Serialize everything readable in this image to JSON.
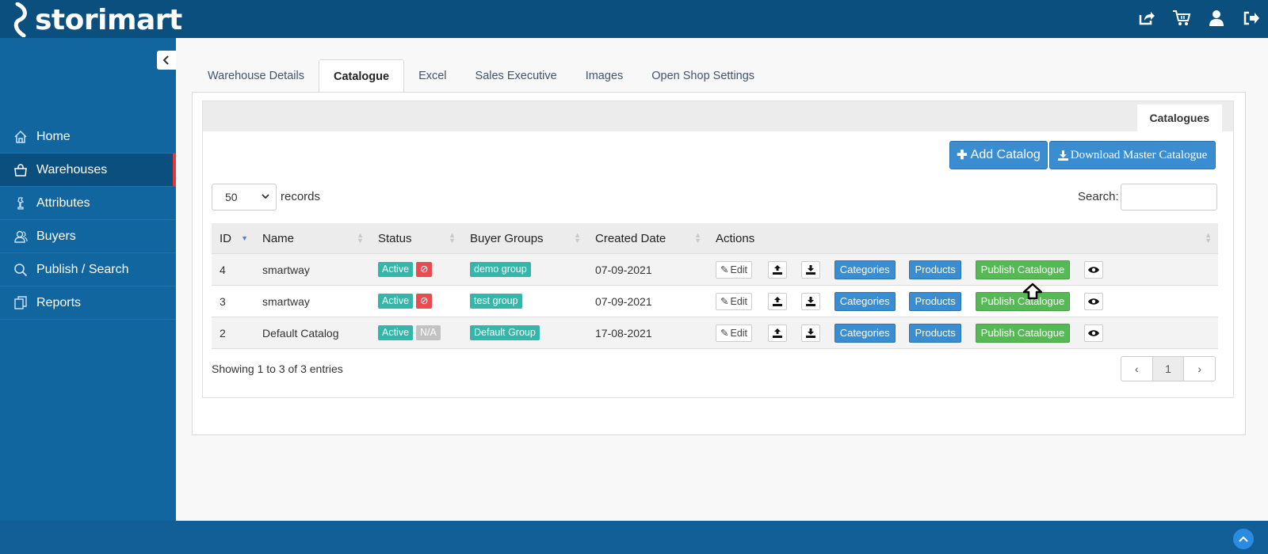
{
  "app": {
    "logo_text": "storimart"
  },
  "header": {
    "icons": [
      "share-icon",
      "cart-icon",
      "user-icon",
      "logout-icon"
    ]
  },
  "sidebar": {
    "items": [
      {
        "label": "Home",
        "icon": "home-icon"
      },
      {
        "label": "Warehouses",
        "icon": "bag-icon",
        "active": true
      },
      {
        "label": "Attributes",
        "icon": "chess-icon"
      },
      {
        "label": "Buyers",
        "icon": "users-icon"
      },
      {
        "label": "Publish / Search",
        "icon": "search-icon"
      },
      {
        "label": "Reports",
        "icon": "copy-icon"
      }
    ]
  },
  "tabs": [
    {
      "label": "Warehouse Details"
    },
    {
      "label": "Catalogue",
      "active": true
    },
    {
      "label": "Excel"
    },
    {
      "label": "Sales Executive"
    },
    {
      "label": "Images"
    },
    {
      "label": "Open Shop Settings"
    }
  ],
  "panel": {
    "section_tab": "Catalogues",
    "add_button": "Add Catalog",
    "download_button": "Download Master Catalogue",
    "page_length": "50",
    "records_label": "records",
    "search_label": "Search:",
    "search_value": ""
  },
  "table": {
    "columns": [
      "ID",
      "Name",
      "Status",
      "Buyer Groups",
      "Created Date",
      "Actions"
    ],
    "rows": [
      {
        "id": "4",
        "name": "smartway",
        "status": "Active",
        "status2": "⊘",
        "buyer_group": "demo group",
        "created": "07-09-2021"
      },
      {
        "id": "3",
        "name": "smartway",
        "status": "Active",
        "status2": "⊘",
        "buyer_group": "test group",
        "created": "07-09-2021"
      },
      {
        "id": "2",
        "name": "Default Catalog",
        "status": "Active",
        "status2": "N/A",
        "buyer_group": "Default Group",
        "created": "17-08-2021"
      }
    ],
    "action_labels": {
      "edit": "Edit",
      "categories": "Categories",
      "products": "Products",
      "publish": "Publish Catalogue"
    }
  },
  "footer": {
    "showing": "Showing 1 to 3 of 3 entries",
    "pager": {
      "prev": "‹",
      "current": "1",
      "next": "›"
    }
  },
  "colors": {
    "header_bg": "#0b4f7f",
    "sidebar_bg": "#1266a0",
    "accent_blue": "#3a8dd0",
    "accent_green": "#56b956",
    "teal": "#36b5a9",
    "red": "#e84b52"
  }
}
